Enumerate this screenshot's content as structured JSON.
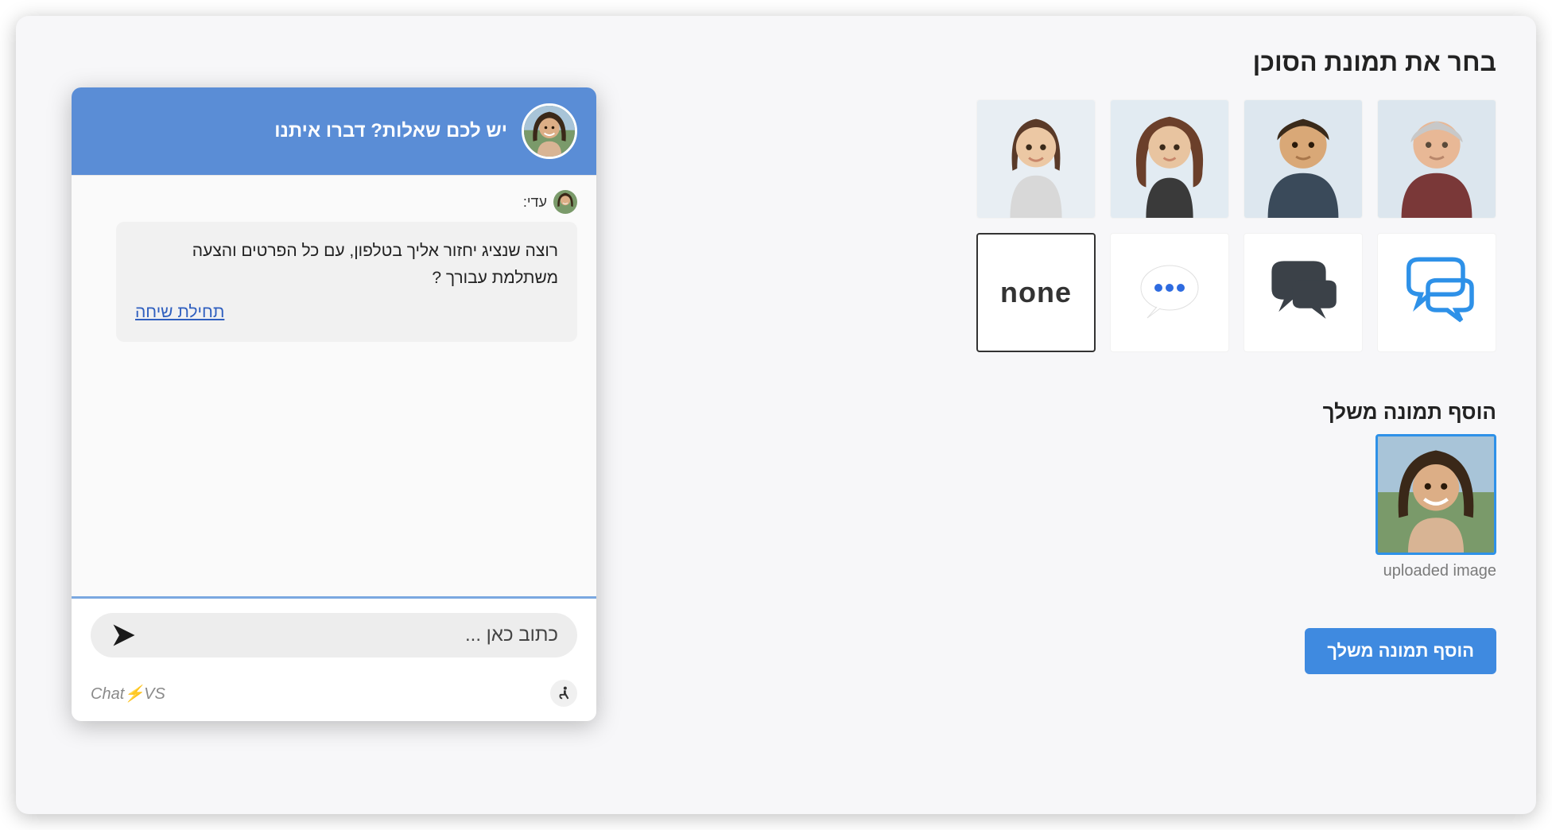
{
  "rightPanel": {
    "title": "בחר את תמונת הסוכן",
    "options": {
      "none_label": "none"
    },
    "upload": {
      "title": "הוסף תמונה משלך",
      "caption": "uploaded image",
      "button": "הוסף תמונה משלך"
    }
  },
  "chat": {
    "header": "יש לכם שאלות? דברו איתנו",
    "agent_name": "עדי:",
    "message": "רוצה שנציג יחזור אליך בטלפון, עם כל הפרטים והצעה משתלמת עבורך ?",
    "link": "תחילת שיחה",
    "input_placeholder": "כתוב כאן ...",
    "brand": "Chat⚡VS"
  }
}
